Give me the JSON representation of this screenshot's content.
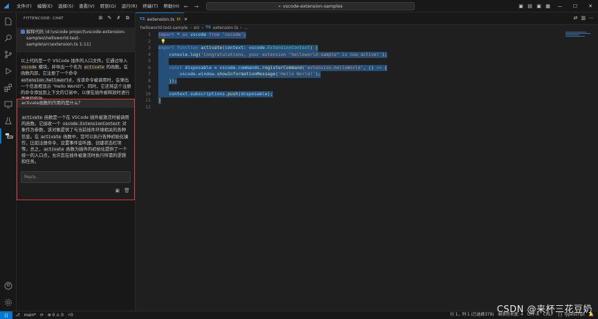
{
  "titlebar": {
    "menu": [
      "文件(F)",
      "编辑(E)",
      "选择(S)",
      "查看(V)",
      "转到(G)",
      "运行(R)",
      "终端(T)",
      "帮助(H)"
    ],
    "search": "vscode-extension-samples"
  },
  "sidebar": {
    "title": "FITTENCODE: CHAT",
    "user_message": "解释代码 (d:\\vscode project\\vscode-extension-samples\\helloworld-test-sample\\src\\extension.ts 1:11)",
    "bot_parts": [
      "以上代码是一个 VSCode 插件的入口文件。它通过导入 ",
      "vscode",
      " 模块，并导出一个名为 ",
      "activate",
      " 的函数。在函数内部，它注册了一个命令 ",
      "extension.helloworld",
      "，当该命令被调用时，会弹出一个信息框显示 \"Hello World!\"。同时，它还将这个注册的命令添加到上下文的订阅中，以便在插件被释放时进行清理和释放。"
    ]
  },
  "chat": {
    "question": "activate函数的作用的是什么？",
    "answer_parts": [
      "activate",
      " 函数是一个在 VSCode 插件被激活时被调用的函数。它接收一个 ",
      "vscode.ExtensionContext",
      " 对象作为参数，该对象提供了与当前插件环境相关的各种信息。在 ",
      "activate",
      " 函数中，您可以执行各种初始化操作，比如注册命令、设置事件监听器、创建状态栏项等。总之，",
      "activate",
      " 函数为插件的初始化提供了一个统一的入口点，允许您在插件被激活时执行所需的逻辑和任务。"
    ],
    "reply_placeholder": "Reply..."
  },
  "editor": {
    "tab_label": "extension.ts",
    "tab_badge": "TS",
    "tab_modified": "M",
    "breadcrumb": [
      "helloworld-test-sample",
      "src",
      "extension.ts",
      "..."
    ],
    "line_numbers": [
      "1",
      "2",
      "3",
      "4",
      "5",
      "6",
      "7",
      "8",
      "9",
      "10",
      "11",
      "12"
    ]
  },
  "statusbar": {
    "branch": "main*",
    "problems": "⊗ 0 ⚠ 0",
    "ports": "⚡0",
    "position": "行 1，列 1 (已选择379)",
    "indent": "制表符长度: 4",
    "encoding": "UTF-8",
    "eol": "CRLF",
    "language": "{} TypeScript"
  },
  "watermark": "CSDN @来杯三花豆奶",
  "colors": {
    "accent": "#0078d4",
    "highlight_box": "#e23a3a",
    "selection": "#264f78"
  }
}
